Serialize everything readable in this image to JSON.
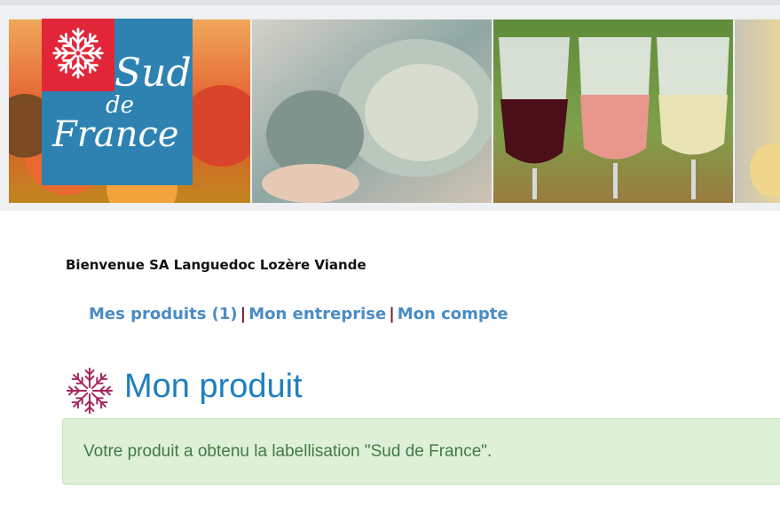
{
  "banner": {
    "logo": {
      "line1": "Sud",
      "line2": "de",
      "line3": "France"
    }
  },
  "welcome": {
    "text": "Bienvenue SA Languedoc Lozère Viande"
  },
  "nav": {
    "items": [
      {
        "label": "Mes produits (1)"
      },
      {
        "label": "Mon entreprise"
      },
      {
        "label": "Mon compte"
      }
    ],
    "separator": "|"
  },
  "page": {
    "title": "Mon produit",
    "icon": "snowflake-emblem-icon"
  },
  "alert": {
    "message": "Votre produit a obtenu la labellisation \"Sud de France\"."
  },
  "colors": {
    "link": "#4a8cc5",
    "separator": "#6a1f3a",
    "title": "#1f7fbf",
    "emblem": "#a8245f",
    "alert_bg": "#dff0d8",
    "alert_text": "#3f7a45",
    "logo_blue": "#2d82b1",
    "logo_red": "#e2263a"
  }
}
